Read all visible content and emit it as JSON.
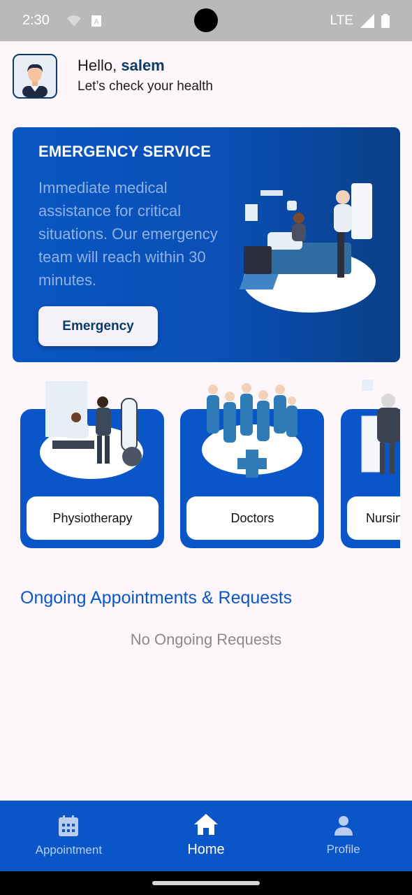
{
  "status_bar": {
    "time": "2:30",
    "network": "LTE"
  },
  "header": {
    "greeting_prefix": "Hello, ",
    "user_name": "salem",
    "subtitle": "Let’s check your health"
  },
  "emergency": {
    "title": "EMERGENCY SERVICE",
    "description": "Immediate medical assistance for critical situations. Our emergency team will reach within 30 minutes.",
    "button_label": "Emergency"
  },
  "services": [
    {
      "label": "Physiotherapy"
    },
    {
      "label": "Doctors"
    },
    {
      "label": "Nursing"
    }
  ],
  "ongoing": {
    "title": "Ongoing Appointments & Requests",
    "empty_message": "No Ongoing Requests"
  },
  "bottom_nav": [
    {
      "label": "Appointment",
      "icon": "calendar-icon"
    },
    {
      "label": "Home",
      "icon": "home-icon"
    },
    {
      "label": "Profile",
      "icon": "person-icon"
    }
  ],
  "colors": {
    "primary": "#0a56c8",
    "dark_blue": "#0b3b66",
    "background": "#fdf7fb"
  }
}
